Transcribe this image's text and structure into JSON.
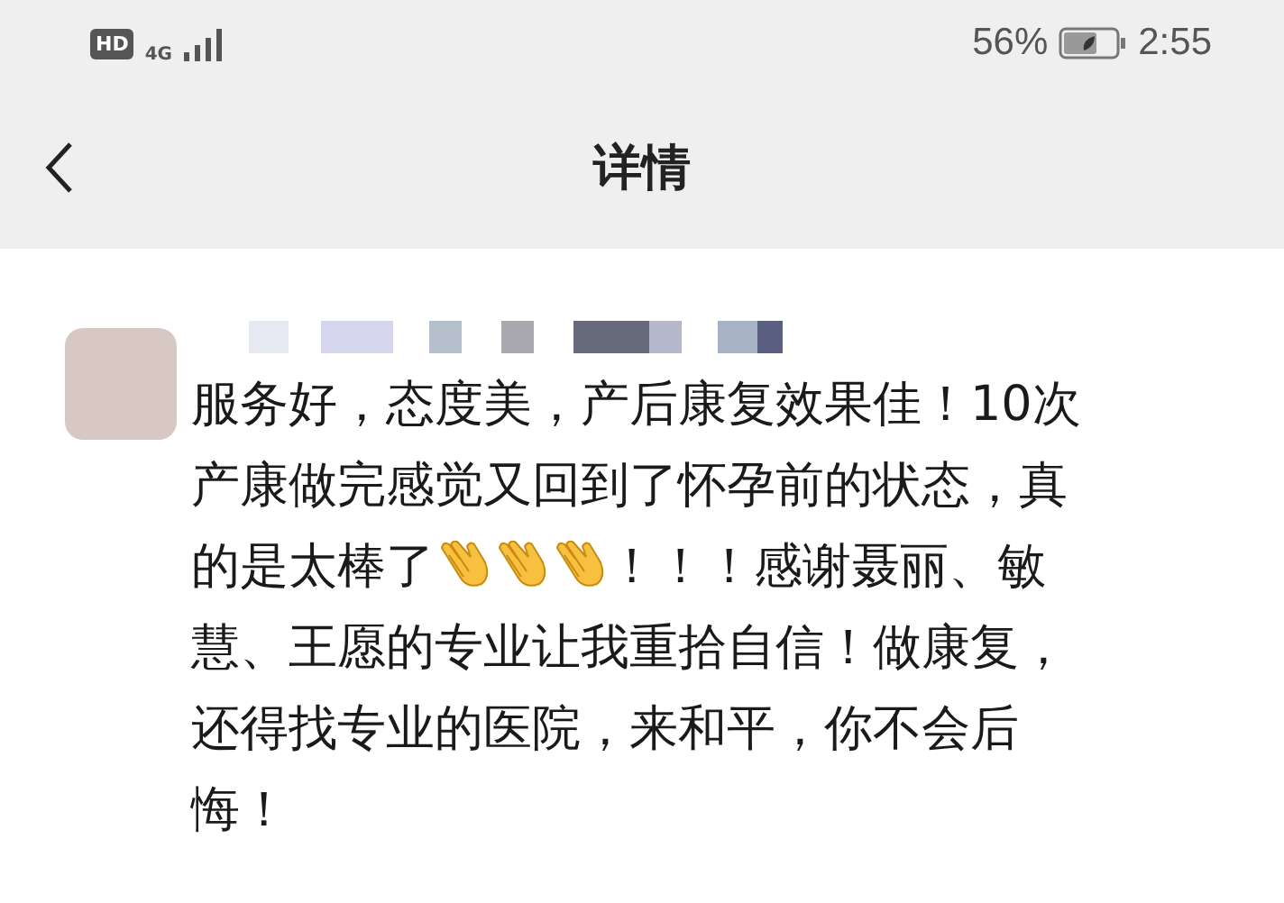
{
  "status_bar": {
    "hd_badge": "HD",
    "network": "4G",
    "battery_percent": "56%",
    "time": "2:55"
  },
  "header": {
    "title": "详情"
  },
  "comment": {
    "lines": [
      [
        {
          "kind": "text",
          "text": "服务好，态度美，产后康复效果佳！10次"
        }
      ],
      [
        {
          "kind": "text",
          "text": "产康做完感觉又回到了怀孕前的状态，真"
        }
      ],
      [
        {
          "kind": "text",
          "text": "的是太棒了"
        },
        {
          "kind": "emoji"
        },
        {
          "kind": "emoji"
        },
        {
          "kind": "emoji"
        },
        {
          "kind": "text",
          "text": "！！！感谢聂丽、敏"
        }
      ],
      [
        {
          "kind": "text",
          "text": "慧、王愿的专业让我重拾自信！做康复，"
        }
      ],
      [
        {
          "kind": "text",
          "text": "还得找专业的医院，来和平，你不会后"
        }
      ],
      [
        {
          "kind": "text",
          "text": "悔！"
        }
      ]
    ]
  }
}
